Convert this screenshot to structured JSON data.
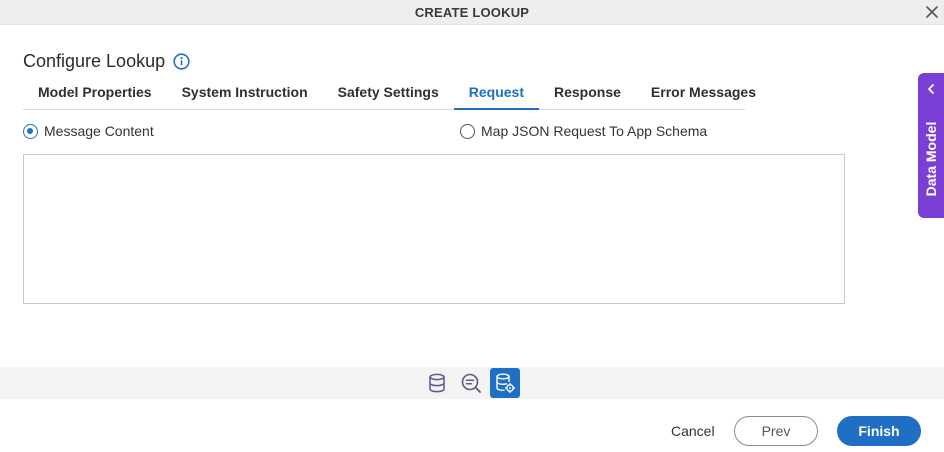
{
  "window": {
    "title": "CREATE LOOKUP"
  },
  "page": {
    "heading": "Configure Lookup"
  },
  "tabs": [
    {
      "label": "Model Properties",
      "active": false
    },
    {
      "label": "System Instruction",
      "active": false
    },
    {
      "label": "Safety Settings",
      "active": false
    },
    {
      "label": "Request",
      "active": true
    },
    {
      "label": "Response",
      "active": false
    },
    {
      "label": "Error Messages",
      "active": false
    }
  ],
  "request": {
    "options": [
      {
        "label": "Message Content",
        "selected": true
      },
      {
        "label": "Map JSON Request To App Schema",
        "selected": false
      }
    ],
    "message_content": ""
  },
  "side_panel": {
    "label": "Data Model"
  },
  "icon_bar": [
    {
      "icon": "database-icon",
      "active": false
    },
    {
      "icon": "search-list-icon",
      "active": false
    },
    {
      "icon": "database-settings-icon",
      "active": true
    }
  ],
  "footer": {
    "cancel_label": "Cancel",
    "prev_label": "Prev",
    "finish_label": "Finish"
  },
  "colors": {
    "accent": "#1f6fc4",
    "side_tab": "#7b3fd6"
  }
}
